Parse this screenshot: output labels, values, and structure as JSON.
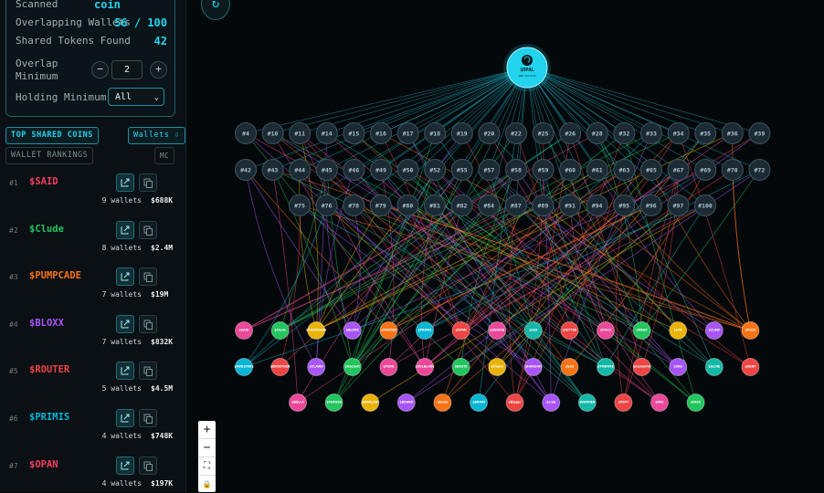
{
  "sidebar": {
    "stats": {
      "scanned_label": "Scanned",
      "scanned_value": "coin",
      "overlap_label": "Overlapping Wallets",
      "overlap_value": "56 / 100",
      "shared_label": "Shared Tokens Found",
      "shared_value": "42",
      "overlap_min_label_1": "Overlap",
      "overlap_min_label_2": "Minimum",
      "overlap_min_value": "2",
      "minus_label": "−",
      "plus_label": "+",
      "holding_min_label": "Holding Minimum",
      "holding_min_value": "All",
      "chevron": "⌄"
    },
    "tabs": {
      "top_shared": "TOP SHARED COINS",
      "wallets": "Wallets ⇩",
      "wallet_rankings": "WALLET RANKINGS",
      "mc": "MC"
    },
    "coins": [
      {
        "rank": "#1",
        "name": "$SAID",
        "wallets": "9 wallets",
        "mc": "$688K",
        "color": "#f43f5e"
      },
      {
        "rank": "#2",
        "name": "$Clude",
        "wallets": "8 wallets",
        "mc": "$2.4M",
        "color": "#22c55e"
      },
      {
        "rank": "#3",
        "name": "$PUMPCADE",
        "wallets": "7 wallets",
        "mc": "$19M",
        "color": "#f97316"
      },
      {
        "rank": "#4",
        "name": "$BLOXX",
        "wallets": "7 wallets",
        "mc": "$832K",
        "color": "#a855f7"
      },
      {
        "rank": "#5",
        "name": "$ROUTER",
        "wallets": "5 wallets",
        "mc": "$4.5M",
        "color": "#ef4444"
      },
      {
        "rank": "#6",
        "name": "$PRIMIS",
        "wallets": "4 wallets",
        "mc": "$748K",
        "color": "#06b6d4"
      },
      {
        "rank": "#7",
        "name": "$OPAN",
        "wallets": "4 wallets",
        "mc": "$197K",
        "color": "#f43f5e"
      }
    ]
  },
  "graph": {
    "center": {
      "label": "$OPAL",
      "sub": "100 wallets",
      "color": "#22d3ee"
    },
    "wallet_rows": [
      [
        "#4",
        "#10",
        "#11",
        "#14",
        "#15",
        "#16",
        "#17",
        "#18",
        "#19",
        "#20",
        "#22",
        "#25",
        "#26",
        "#28",
        "#32",
        "#33",
        "#34",
        "#35",
        "#36",
        "#39"
      ],
      [
        "#42",
        "#43",
        "#44",
        "#45",
        "#46",
        "#49",
        "#50",
        "#52",
        "#55",
        "#57",
        "#58",
        "#59",
        "#60",
        "#61",
        "#63",
        "#65",
        "#67",
        "#69",
        "#70",
        "#72"
      ],
      [
        "#75",
        "#76",
        "#78",
        "#79",
        "#80",
        "#81",
        "#82",
        "#84",
        "#87",
        "#89",
        "#91",
        "#94",
        "#95",
        "#96",
        "#97",
        "#100"
      ]
    ],
    "coin_rows": [
      [
        {
          "label": "$SAID",
          "color": "#ec4899"
        },
        {
          "label": "$Clude",
          "color": "#22c55e"
        },
        {
          "label": "$PUMPCADE",
          "color": "#eab308"
        },
        {
          "label": "$BLOXX",
          "color": "#a855f7"
        },
        {
          "label": "$ROUTER",
          "color": "#f97316"
        },
        {
          "label": "$PRIMIS",
          "color": "#06b6d4"
        },
        {
          "label": "$OPAN",
          "color": "#ef4444"
        },
        {
          "label": "$SQUIRE",
          "color": "#ec4899"
        },
        {
          "label": "$SEA",
          "color": "#14b8a6"
        },
        {
          "label": "$FETTER",
          "color": "#ef4444"
        },
        {
          "label": "$PHLO",
          "color": "#ec4899"
        },
        {
          "label": "$MEEK",
          "color": "#22c55e"
        },
        {
          "label": "$SOL",
          "color": "#eab308"
        },
        {
          "label": "$CLAW",
          "color": "#a855f7"
        },
        {
          "label": "$PLUG",
          "color": "#f97316"
        }
      ],
      [
        {
          "label": "$ANDSTAKE",
          "color": "#06b6d4"
        },
        {
          "label": "$BROETHER",
          "color": "#ef4444"
        },
        {
          "label": "$CLAWD",
          "color": "#a855f7"
        },
        {
          "label": "$NoLimit",
          "color": "#22c55e"
        },
        {
          "label": "$PENG",
          "color": "#ec4899"
        },
        {
          "label": "$SOLBLADE",
          "color": "#ec4899"
        },
        {
          "label": "$BASTE",
          "color": "#22c55e"
        },
        {
          "label": "$Trader",
          "color": "#eab308"
        },
        {
          "label": "$HANSON",
          "color": "#a855f7"
        },
        {
          "label": "$SSA",
          "color": "#f97316"
        },
        {
          "label": "$TRIBORE",
          "color": "#14b8a6"
        },
        {
          "label": "$memePet",
          "color": "#ef4444"
        },
        {
          "label": "$ENS",
          "color": "#a855f7"
        },
        {
          "label": "$ALINE",
          "color": "#14b8a6"
        },
        {
          "label": "$NEDY",
          "color": "#ef4444"
        }
      ],
      [
        {
          "label": "$BELLA",
          "color": "#ec4899"
        },
        {
          "label": "$PHASER",
          "color": "#22c55e"
        },
        {
          "label": "$RAVILION",
          "color": "#eab308"
        },
        {
          "label": "$BOARD",
          "color": "#a855f7"
        },
        {
          "label": "$lamb",
          "color": "#f97316"
        },
        {
          "label": "$BRAIN",
          "color": "#06b6d4"
        },
        {
          "label": "$Bigger",
          "color": "#ef4444"
        },
        {
          "label": "$crab",
          "color": "#a855f7"
        },
        {
          "label": "$BUNNER",
          "color": "#14b8a6"
        },
        {
          "label": "$PEPT",
          "color": "#ef4444"
        },
        {
          "label": "$ARC",
          "color": "#ec4899"
        },
        {
          "label": "$FACE",
          "color": "#22c55e"
        }
      ]
    ],
    "zoom": {
      "in": "+",
      "out": "−",
      "fit": "⛶",
      "lock": "🔒"
    },
    "refresh": "↻"
  }
}
